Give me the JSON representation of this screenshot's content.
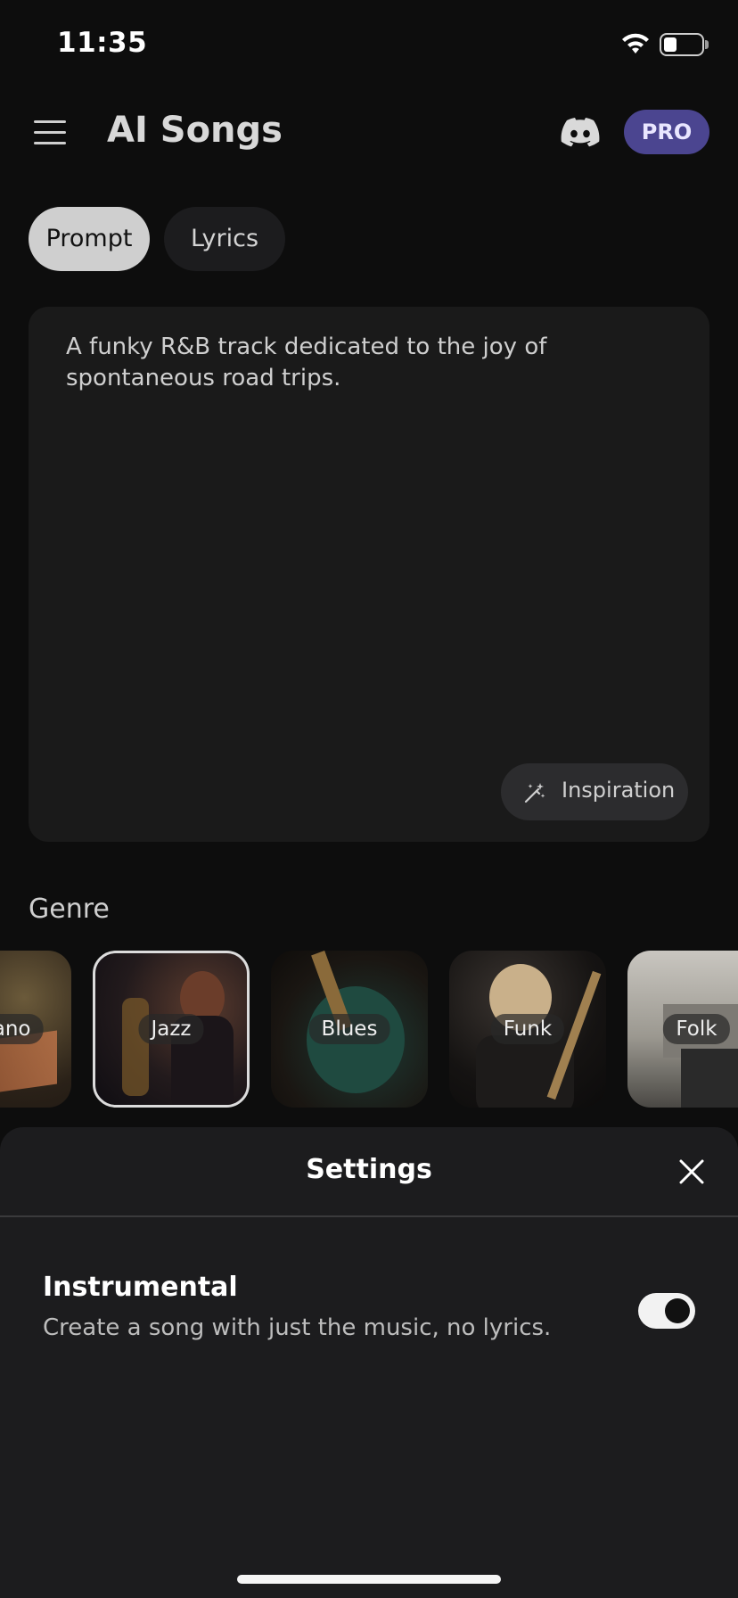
{
  "status_bar": {
    "time": "11:35"
  },
  "header": {
    "title": "AI Songs",
    "pro_label": "PRO"
  },
  "tabs": [
    {
      "label": "Prompt",
      "active": true
    },
    {
      "label": "Lyrics",
      "active": false
    }
  ],
  "prompt": {
    "text": "A funky R&B track dedicated to the joy of spontaneous road trips.",
    "inspiration_label": "Inspiration"
  },
  "genre": {
    "label": "Genre",
    "items": [
      {
        "name": "Piano",
        "visible_text": "ano",
        "selected": false
      },
      {
        "name": "Jazz",
        "visible_text": "Jazz",
        "selected": true
      },
      {
        "name": "Blues",
        "visible_text": "Blues",
        "selected": false
      },
      {
        "name": "Funk",
        "visible_text": "Funk",
        "selected": false
      },
      {
        "name": "Folk",
        "visible_text": "Folk",
        "selected": false
      }
    ]
  },
  "settings": {
    "title": "Settings",
    "instrumental": {
      "title": "Instrumental",
      "description": "Create a song with just the music, no lyrics.",
      "enabled": true
    }
  },
  "colors": {
    "accent": "#4b4590",
    "background": "#0d0d0d",
    "sheet": "#1c1c1e"
  }
}
